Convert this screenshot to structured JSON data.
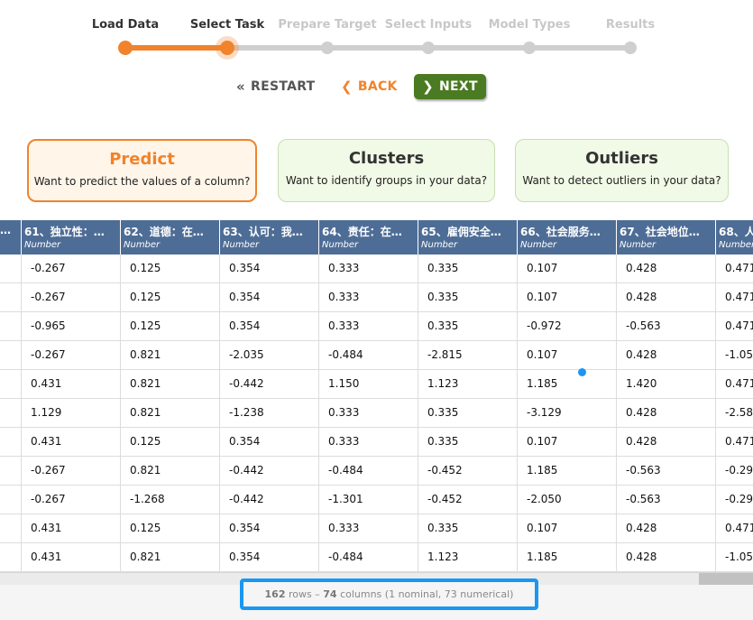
{
  "steps": [
    {
      "label": "Load Data",
      "state": "done"
    },
    {
      "label": "Select Task",
      "state": "current"
    },
    {
      "label": "Prepare Target",
      "state": "todo"
    },
    {
      "label": "Select Inputs",
      "state": "todo"
    },
    {
      "label": "Model Types",
      "state": "todo"
    },
    {
      "label": "Results",
      "state": "todo"
    }
  ],
  "nav": {
    "restart_label": "RESTART",
    "restart_icon": "double-chevron-left-icon",
    "back_label": "BACK",
    "back_icon": "chevron-left-icon",
    "next_label": "NEXT",
    "next_icon": "chevron-right-icon"
  },
  "tasks": {
    "predict": {
      "title": "Predict",
      "desc": "Want to predict the values of a column?"
    },
    "clusters": {
      "title": "Clusters",
      "desc": "Want to identify groups in your data?"
    },
    "outliers": {
      "title": "Outliers",
      "desc": "Want to detect outliers in your data?"
    }
  },
  "table": {
    "columns": [
      {
        "name": "…",
        "type": ""
      },
      {
        "name": "61、独立性：…",
        "type": "Number"
      },
      {
        "name": "62、道德：在…",
        "type": "Number"
      },
      {
        "name": "63、认可：我…",
        "type": "Number"
      },
      {
        "name": "64、责任：在…",
        "type": "Number"
      },
      {
        "name": "65、雇佣安全…",
        "type": "Number"
      },
      {
        "name": "66、社会服务…",
        "type": "Number"
      },
      {
        "name": "67、社会地位…",
        "type": "Number"
      },
      {
        "name": "68、人…",
        "type": "Number"
      }
    ],
    "rows": [
      [
        "",
        "-0.267",
        "0.125",
        "0.354",
        "0.333",
        "0.335",
        "0.107",
        "0.428",
        "0.471"
      ],
      [
        "",
        "-0.267",
        "0.125",
        "0.354",
        "0.333",
        "0.335",
        "0.107",
        "0.428",
        "0.471"
      ],
      [
        "",
        "-0.965",
        "0.125",
        "0.354",
        "0.333",
        "0.335",
        "-0.972",
        "-0.563",
        "0.471"
      ],
      [
        "",
        "-0.267",
        "0.821",
        "-2.035",
        "-0.484",
        "-2.815",
        "0.107",
        "0.428",
        "-1.05"
      ],
      [
        "",
        "0.431",
        "0.821",
        "-0.442",
        "1.150",
        "1.123",
        "1.185",
        "1.420",
        "0.471"
      ],
      [
        "",
        "1.129",
        "0.821",
        "-1.238",
        "0.333",
        "0.335",
        "-3.129",
        "0.428",
        "-2.58"
      ],
      [
        "",
        "0.431",
        "0.125",
        "0.354",
        "0.333",
        "0.335",
        "0.107",
        "0.428",
        "0.471"
      ],
      [
        "",
        "-0.267",
        "0.821",
        "-0.442",
        "-0.484",
        "-0.452",
        "1.185",
        "-0.563",
        "-0.29"
      ],
      [
        "",
        "-0.267",
        "-1.268",
        "-0.442",
        "-1.301",
        "-0.452",
        "-2.050",
        "-0.563",
        "-0.29"
      ],
      [
        "",
        "0.431",
        "0.125",
        "0.354",
        "0.333",
        "0.335",
        "0.107",
        "0.428",
        "0.471"
      ],
      [
        "",
        "0.431",
        "0.821",
        "0.354",
        "-0.484",
        "1.123",
        "1.185",
        "0.428",
        "-1.05"
      ]
    ]
  },
  "summary": {
    "rows_count": "162",
    "rows_word": "rows",
    "separator": "–",
    "cols_count": "74",
    "cols_text": "columns (1 nominal, 73 numerical)"
  },
  "colors": {
    "accent": "#f0832b",
    "next_button": "#4a7a21",
    "table_header": "#4e6d96",
    "highlight": "#1a97f0"
  }
}
